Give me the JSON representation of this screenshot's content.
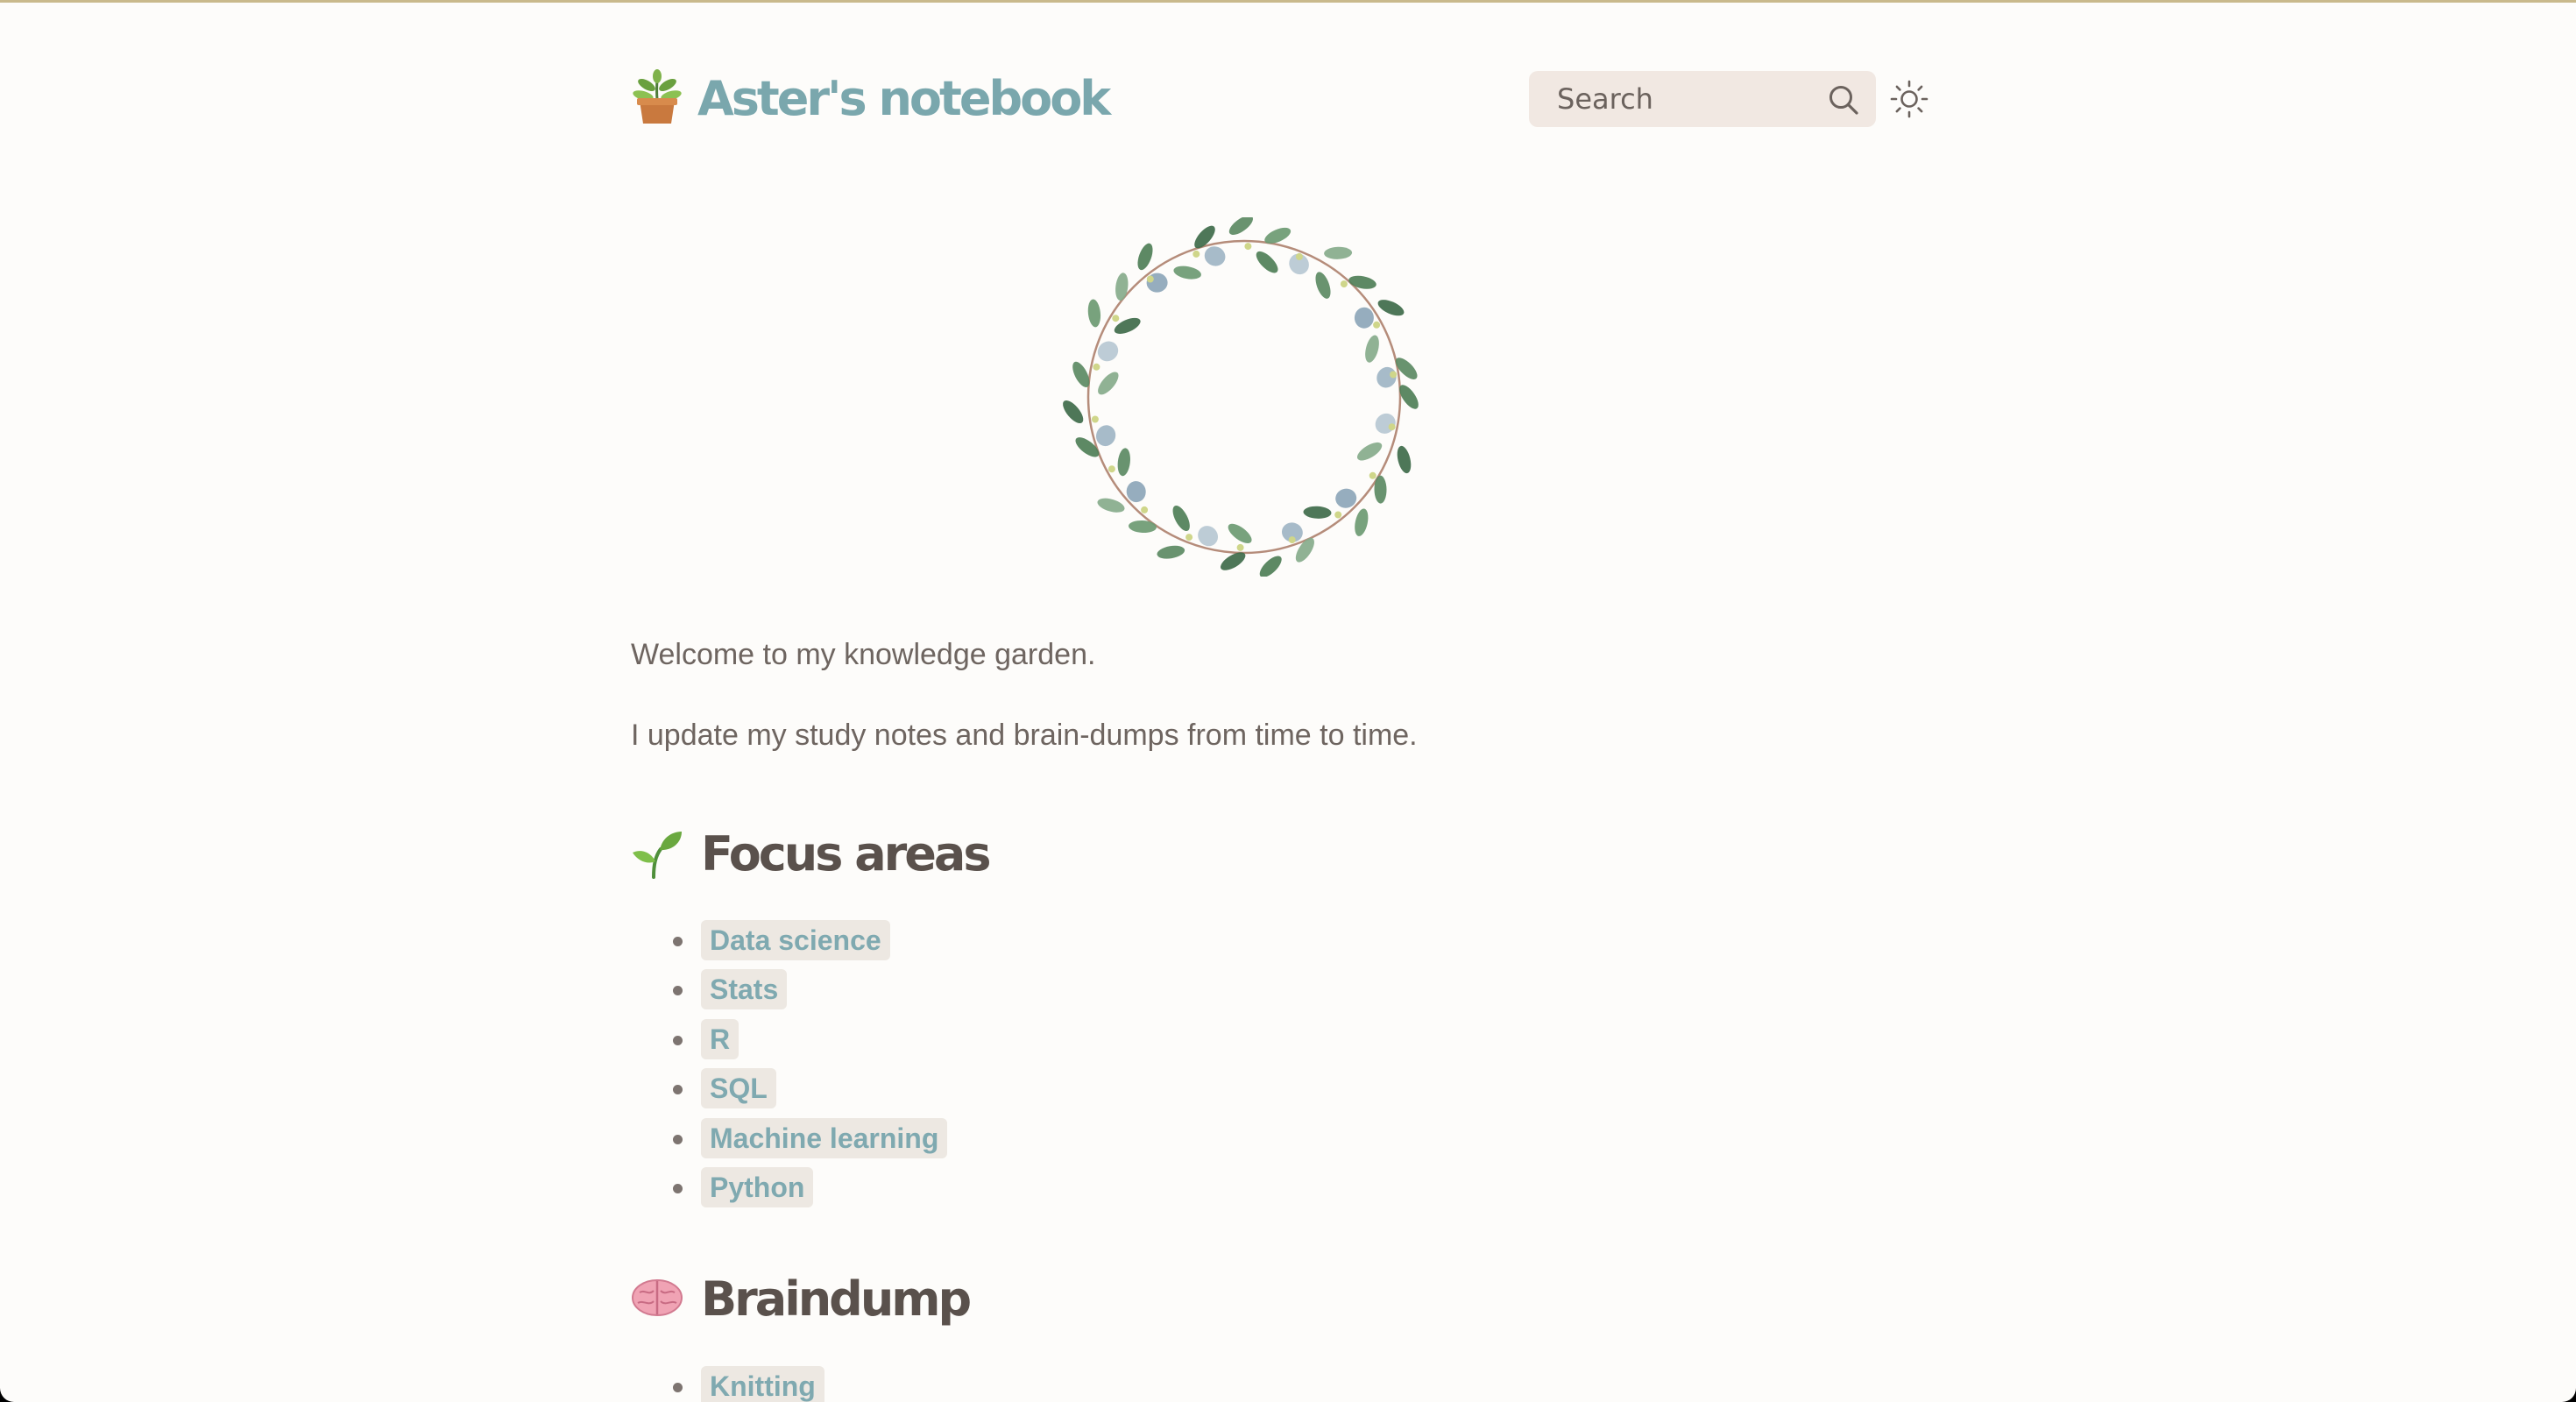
{
  "header": {
    "title": "Aster's notebook",
    "logo_icon": "potted-plant-icon",
    "search_placeholder": "Search",
    "theme_toggle_icon": "sun-icon"
  },
  "intro": {
    "line1": "Welcome to my knowledge garden.",
    "line2": "I update my study notes and brain-dumps from time to time."
  },
  "focus": {
    "title": "Focus areas",
    "icon": "seedling-icon",
    "items": [
      "Data science",
      "Stats",
      "R",
      "SQL",
      "Machine learning",
      "Python"
    ]
  },
  "braindump": {
    "title": "Braindump",
    "icon": "brain-icon",
    "items": [
      "Knitting"
    ]
  },
  "colors": {
    "background": "#fdfcfa",
    "accent": "#7aa7ad",
    "heading": "#5a514c",
    "text": "#6e6560",
    "search_bg": "#f1e8e2",
    "link_bg": "#ede8e2"
  }
}
